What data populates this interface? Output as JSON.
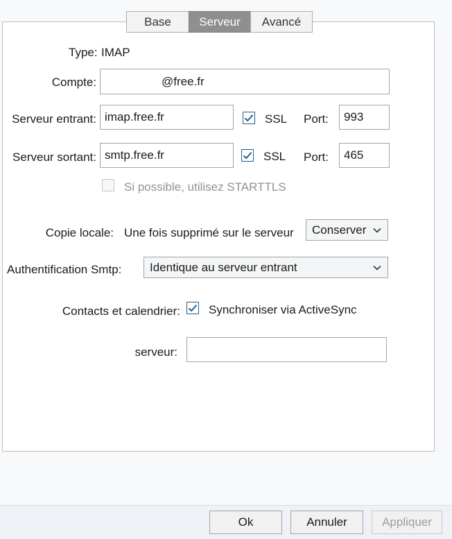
{
  "tabs": [
    {
      "label": "Base",
      "active": false
    },
    {
      "label": "Serveur",
      "active": true
    },
    {
      "label": "Avancé",
      "active": false
    }
  ],
  "type": {
    "label": "Type:",
    "value": "IMAP"
  },
  "account": {
    "label": "Compte:",
    "value": "@free.fr"
  },
  "incoming": {
    "label": "Serveur entrant:",
    "value": "imap.free.fr",
    "ssl_label": "SSL",
    "ssl_checked": true,
    "port_label": "Port:",
    "port_value": "993"
  },
  "outgoing": {
    "label": "Serveur sortant:",
    "value": "smtp.free.fr",
    "ssl_label": "SSL",
    "ssl_checked": true,
    "port_label": "Port:",
    "port_value": "465"
  },
  "starttls": {
    "label": "Si possible, utilisez STARTTLS",
    "checked": false,
    "enabled": false
  },
  "local_copy": {
    "label": "Copie locale:",
    "description": "Une fois supprimé sur le serveur",
    "selected": "Conserver"
  },
  "smtp_auth": {
    "label": "Authentification Smtp:",
    "selected": "Identique au serveur entrant"
  },
  "contacts": {
    "label": "Contacts et calendrier:",
    "checkbox_label": "Synchroniser via ActiveSync",
    "checked": true
  },
  "server": {
    "label": "serveur:",
    "value": ""
  },
  "buttons": {
    "ok": "Ok",
    "cancel": "Annuler",
    "apply": "Appliquer"
  },
  "colors": {
    "check_blue": "#1f5f91",
    "active_tab": "#8f8f8f"
  }
}
